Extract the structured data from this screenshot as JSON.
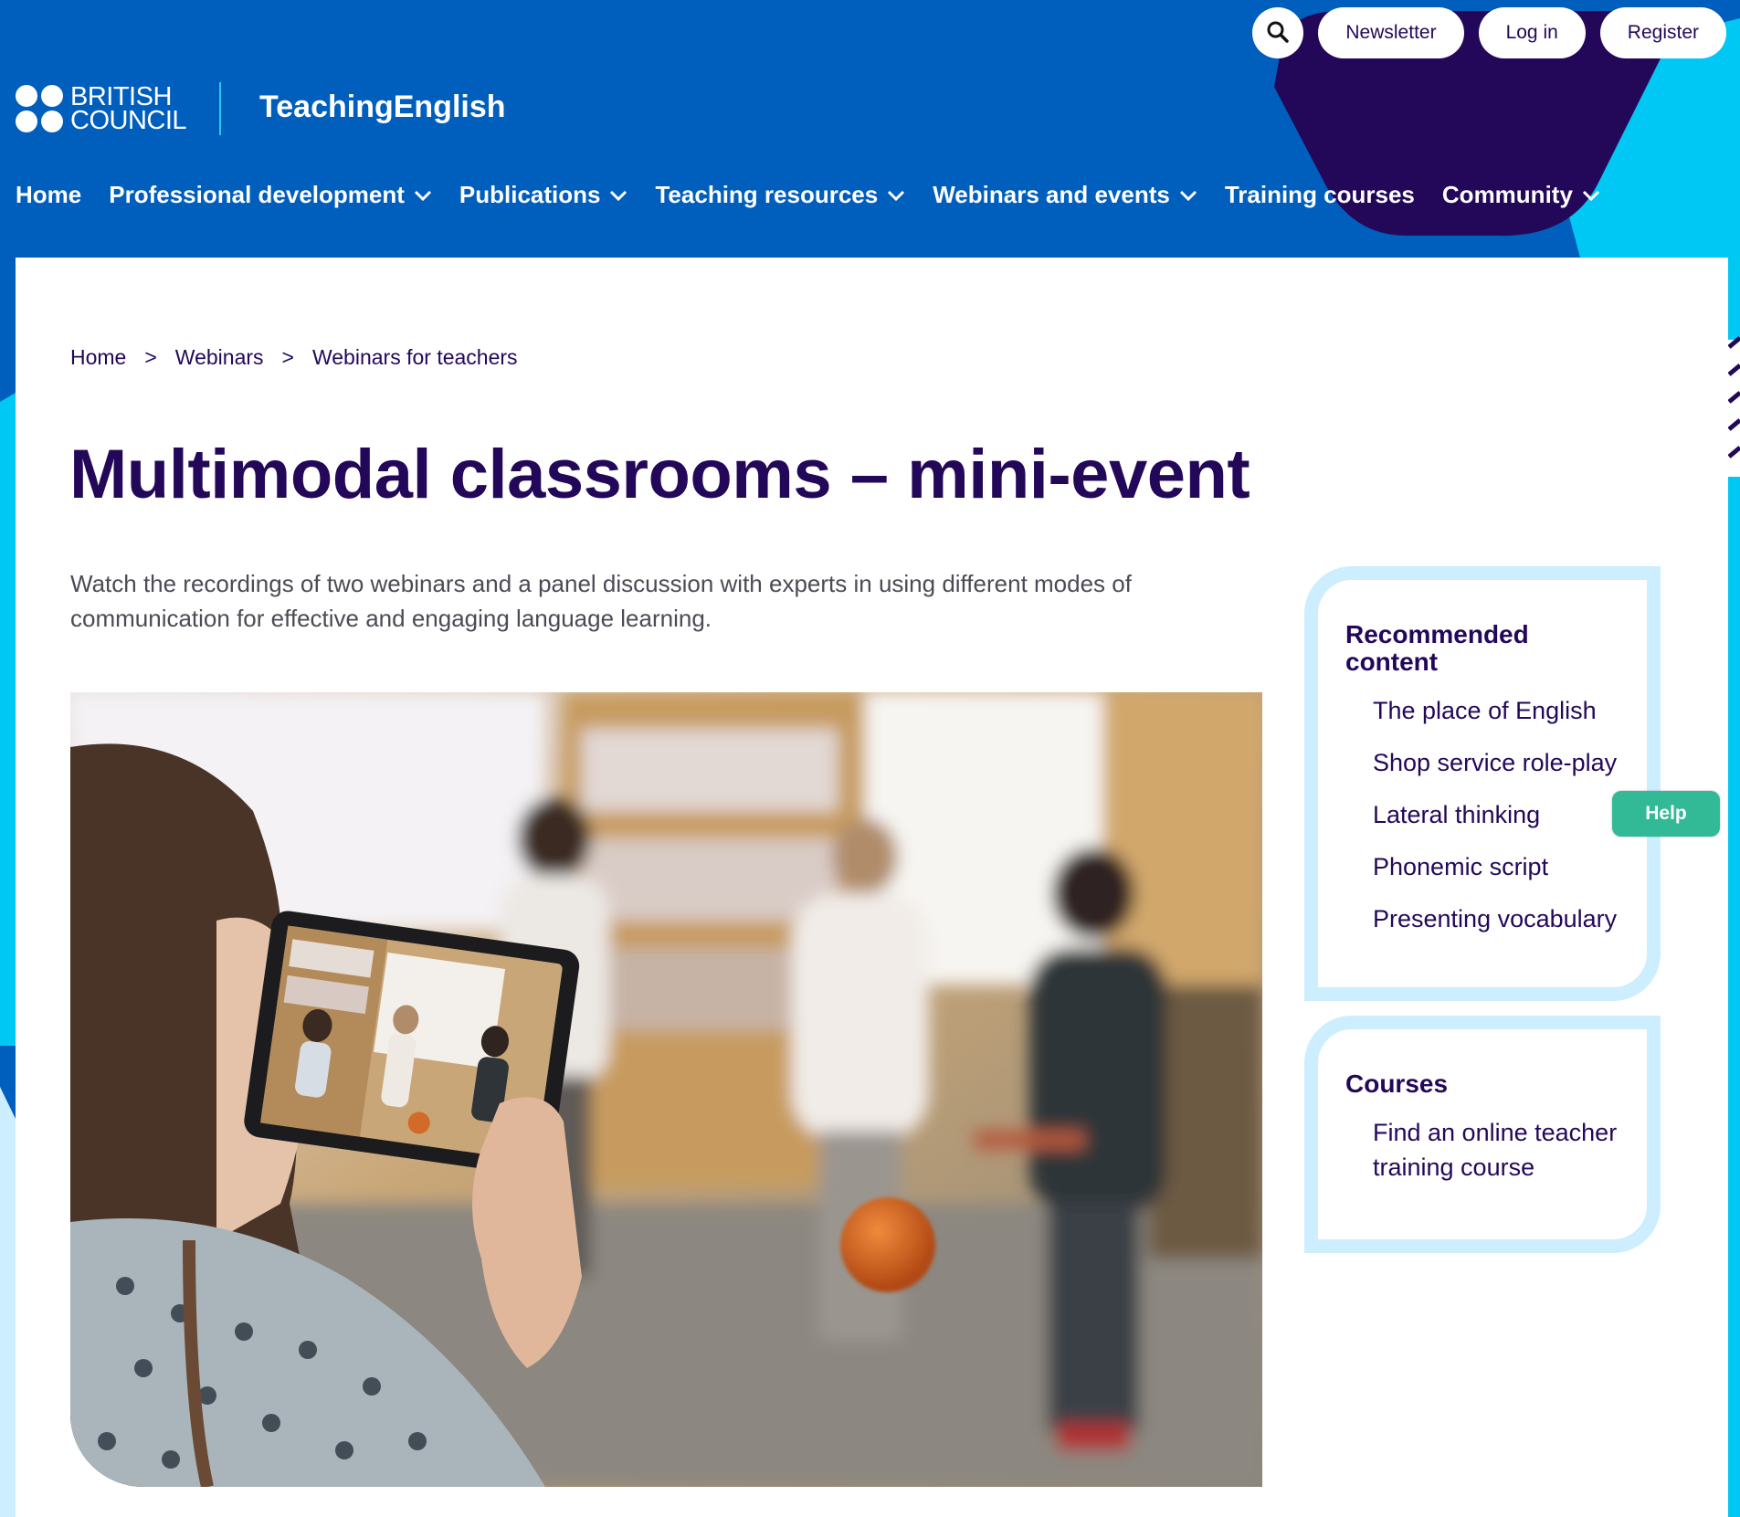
{
  "header": {
    "logo_text": [
      "BRITISH",
      "COUNCIL"
    ],
    "site_name": "TeachingEnglish",
    "top_buttons": {
      "newsletter": "Newsletter",
      "login": "Log in",
      "register": "Register"
    },
    "nav": [
      {
        "label": "Home",
        "has_dropdown": false
      },
      {
        "label": "Professional development",
        "has_dropdown": true
      },
      {
        "label": "Publications",
        "has_dropdown": true
      },
      {
        "label": "Teaching resources",
        "has_dropdown": true
      },
      {
        "label": "Webinars and events",
        "has_dropdown": true
      },
      {
        "label": "Training courses",
        "has_dropdown": false
      },
      {
        "label": "Community",
        "has_dropdown": true
      }
    ]
  },
  "breadcrumb": [
    "Home",
    "Webinars",
    "Webinars for teachers"
  ],
  "breadcrumb_separator": ">",
  "page": {
    "title": "Multimodal classrooms – mini-event",
    "intro": "Watch the recordings of two webinars and a panel discussion with experts in using different modes of communication for effective and engaging language learning."
  },
  "sidebar": {
    "recommended": {
      "title": "Recommended content",
      "items": [
        "The place of English",
        "Shop service role-play",
        "Lateral thinking",
        "Phonemic script",
        "Presenting vocabulary"
      ]
    },
    "courses": {
      "title": "Courses",
      "items": [
        "Find an online teacher training course"
      ]
    }
  },
  "help_label": "Help",
  "icons": {
    "search": "search-icon",
    "chevron": "chevron-down-icon"
  },
  "colors": {
    "brand_blue": "#005ebc",
    "navy": "#23085a",
    "light_blue": "#cceeff",
    "cyan": "#00c8f5",
    "help_green": "#32b996"
  }
}
